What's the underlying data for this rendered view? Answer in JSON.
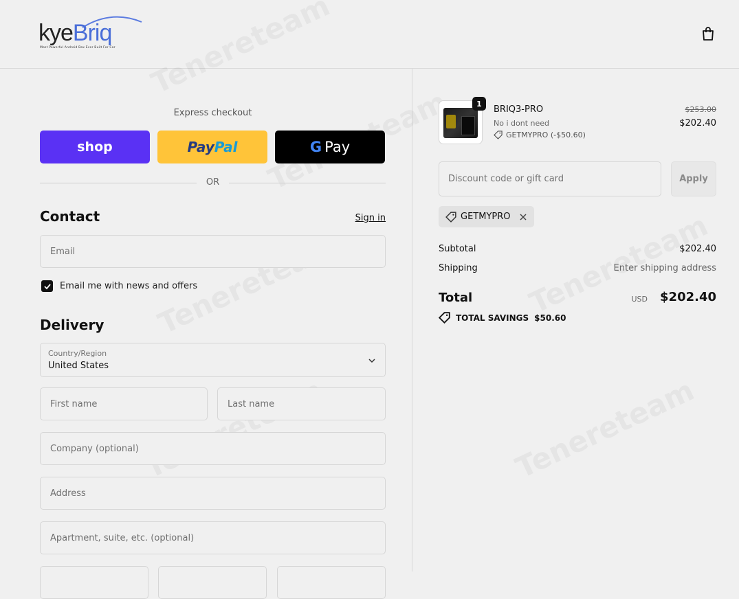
{
  "header": {
    "brand_main": "kye",
    "brand_accent": "Briq",
    "brand_tagline": "Most Powerful Android Box Ever Built For Car",
    "cart_icon": "shopping-bag-icon"
  },
  "checkout": {
    "express_title": "Express checkout",
    "shop_label": "shop",
    "paypal_label_1": "Pay",
    "paypal_label_2": "Pal",
    "gpay_g": "G",
    "gpay_label": "Pay",
    "or_label": "OR",
    "contact_title": "Contact",
    "sign_in": "Sign in",
    "email_placeholder": "Email",
    "newsletter_label": "Email me with news and offers",
    "newsletter_checked": true,
    "delivery_title": "Delivery",
    "country_label": "Country/Region",
    "country_value": "United States",
    "first_name_placeholder": "First name",
    "last_name_placeholder": "Last name",
    "company_placeholder": "Company (optional)",
    "address_placeholder": "Address",
    "apartment_placeholder": "Apartment, suite, etc. (optional)"
  },
  "summary": {
    "product": {
      "quantity": "1",
      "name": "BRIQ3-PRO",
      "variant": "No i dont need",
      "discount": "GETMYPRO (-$50.60)",
      "price_original": "$253.00",
      "price_final": "$202.40"
    },
    "discount_placeholder": "Discount code or gift card",
    "apply_label": "Apply",
    "applied_code": "GETMYPRO",
    "subtotal_label": "Subtotal",
    "subtotal_value": "$202.40",
    "shipping_label": "Shipping",
    "shipping_value": "Enter shipping address",
    "total_label": "Total",
    "currency": "USD",
    "total_value": "$202.40",
    "savings_label": "TOTAL SAVINGS",
    "savings_value": "$50.60"
  },
  "colors": {
    "shop": "#5a31f4",
    "paypal": "#ffc439",
    "gpay": "#000000",
    "background": "#f0f0f0"
  }
}
